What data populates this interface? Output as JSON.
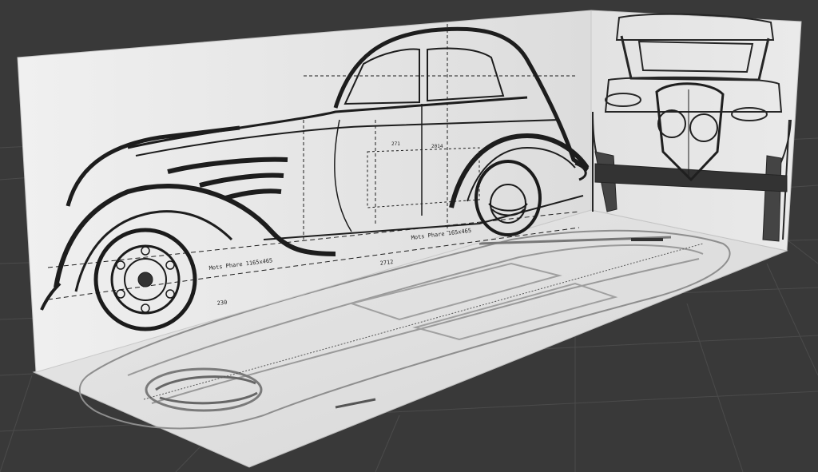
{
  "viewport": {
    "background_color": "#393939",
    "grid_color": "#4b4b4b"
  },
  "planes": {
    "side": {
      "label": "side-view blueprint plane",
      "paper_color": "#e9e9e9",
      "dimension_labels": [
        "Mots Phare 1165x465",
        "Mots Phare 165x465",
        "2712",
        "230",
        "271",
        "2014"
      ]
    },
    "front": {
      "label": "front-view blueprint plane",
      "paper_color": "#e4e4e4"
    },
    "floor": {
      "label": "top-view blueprint plane",
      "paper_color": "#dedede"
    }
  },
  "icons": {
    "side_wheel": "wheel-icon",
    "grille": "grille-icon"
  }
}
